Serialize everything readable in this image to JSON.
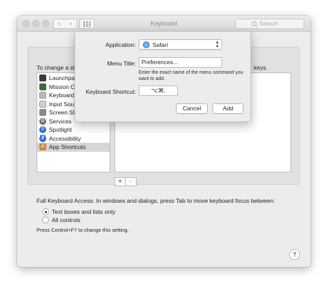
{
  "window": {
    "title": "Keyboard",
    "search_placeholder": "Search",
    "back_glyph": "‹",
    "forward_glyph": "›"
  },
  "main": {
    "instruction_prefix": "To change a sh",
    "instruction_suffix": "keys.",
    "categories": [
      {
        "label": "Launchpa",
        "icon": "launchpad-icon",
        "color": "#3a3a3a"
      },
      {
        "label": "Mission C",
        "icon": "mission-control-icon",
        "color": "#3d6a3a"
      },
      {
        "label": "Keyboard",
        "icon": "keyboard-icon",
        "color": "#b9b9b9"
      },
      {
        "label": "Input Sour",
        "icon": "input-sources-icon",
        "color": "#d0d0d0"
      },
      {
        "label": "Screen Sh",
        "icon": "screenshot-icon",
        "color": "#8a8a8a"
      },
      {
        "label": "Services",
        "icon": "services-gear-icon",
        "color": "#6f6f6f"
      },
      {
        "label": "Spotlight",
        "icon": "spotlight-icon",
        "color": "#2f6fd3"
      },
      {
        "label": "Accessibility",
        "icon": "accessibility-icon",
        "color": "#2f6fd3"
      },
      {
        "label": "App Shortcuts",
        "icon": "app-shortcuts-icon",
        "color": "#c98a3d"
      }
    ],
    "selected_category": "App Shortcuts",
    "add_label": "+",
    "remove_label": "−",
    "full_keyboard_access": "Full Keyboard Access: In windows and dialogs, press Tab to move keyboard focus between:",
    "radio_options": [
      {
        "label": "Text boxes and lists only",
        "selected": true
      },
      {
        "label": "All controls",
        "selected": false
      }
    ],
    "note": "Press Control+F7 to change this setting.",
    "help_label": "?"
  },
  "sheet": {
    "application_label": "Application:",
    "application_value": "Safari",
    "menu_title_label": "Menu Title:",
    "menu_title_value": "Preferences...",
    "hint": "Enter the exact name of the menu command you want to add.",
    "shortcut_label": "Keyboard Shortcut:",
    "shortcut_value": "⌥⌘,",
    "cancel_label": "Cancel",
    "add_label": "Add"
  },
  "colors": {
    "window_bg": "#ececec",
    "selection": "#d6d6d6",
    "accent": "#3b76d6"
  }
}
